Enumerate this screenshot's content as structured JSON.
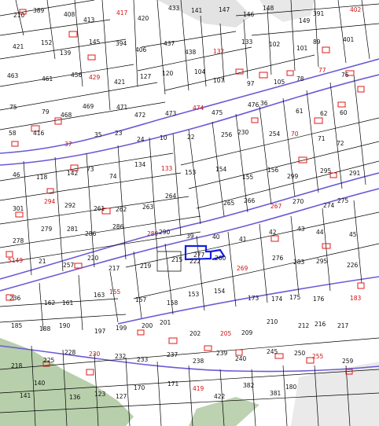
{
  "map": {
    "colors": {
      "background": "#ffffff",
      "parcel_line": "#000000",
      "road_line": "#6b5bd6",
      "building_outline": "#e01818",
      "highlight": "#1520e0",
      "relief_green": "#9fbf8f",
      "relief_gray": "#d9d9d9"
    },
    "highlighted_parcel": "277",
    "parcel_labels": [
      "210",
      "389",
      "408",
      "413",
      "417",
      "420",
      "433",
      "141",
      "147",
      "146",
      "148",
      "149",
      "391",
      "402",
      "421",
      "152",
      "139",
      "145",
      "394",
      "406",
      "437",
      "438",
      "132",
      "133",
      "102",
      "101",
      "89",
      "401",
      "463",
      "461",
      "456",
      "429",
      "421",
      "127",
      "120",
      "104",
      "107",
      "97",
      "105",
      "78",
      "77",
      "76",
      "75",
      "79",
      "468",
      "469",
      "471",
      "472",
      "473",
      "474",
      "475",
      "476",
      "36",
      "61",
      "62",
      "60",
      "58",
      "416",
      "37",
      "35",
      "23",
      "24",
      "10",
      "22",
      "256",
      "230",
      "254",
      "70",
      "71",
      "72",
      "46",
      "118",
      "142",
      "73",
      "74",
      "134",
      "133",
      "153",
      "154",
      "155",
      "156",
      "299",
      "295",
      "291",
      "301",
      "294",
      "292",
      "261",
      "262",
      "263",
      "264",
      "277",
      "265",
      "266",
      "267",
      "270",
      "274",
      "275",
      "278",
      "279",
      "281",
      "286",
      "286",
      "289",
      "290",
      "39",
      "40",
      "41",
      "42",
      "43",
      "44",
      "45",
      "5149",
      "21",
      "257",
      "220",
      "217",
      "219",
      "215",
      "222",
      "260",
      "269",
      "276",
      "283",
      "295",
      "226",
      "236",
      "162",
      "161",
      "163",
      "155",
      "157",
      "158",
      "153",
      "154",
      "173",
      "174",
      "175",
      "176",
      "183",
      "185",
      "188",
      "190",
      "197",
      "199",
      "200",
      "201",
      "202",
      "205",
      "209",
      "210",
      "212",
      "216",
      "217",
      "218",
      "225",
      "228",
      "230",
      "232",
      "233",
      "237",
      "238",
      "239",
      "240",
      "245",
      "250",
      "255",
      "259",
      "141",
      "140",
      "136",
      "123",
      "127",
      "170",
      "171",
      "419",
      "422",
      "382",
      "381",
      "180"
    ]
  }
}
